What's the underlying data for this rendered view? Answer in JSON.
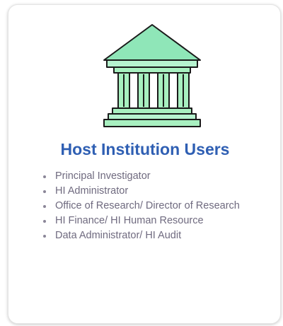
{
  "card": {
    "icon": "institution-building-icon",
    "title": "Host Institution Users",
    "roles": [
      "Principal Investigator",
      "HI Administrator",
      "Office of Research/ Director of Research",
      "HI Finance/ HI Human Resource",
      "Data Administrator/ HI Audit"
    ]
  },
  "colors": {
    "title": "#2f5fb3",
    "list_text": "#6f6a7f",
    "icon_fill": "#a8f0c0",
    "icon_roof": "#8fe6b8",
    "icon_stroke": "#1a1a1a"
  }
}
